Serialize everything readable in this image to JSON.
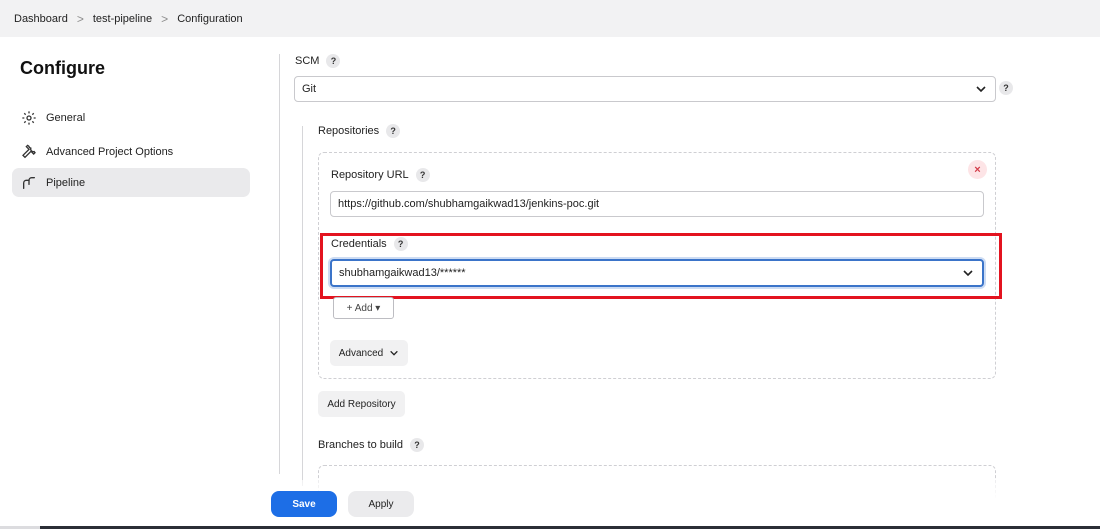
{
  "breadcrumb": {
    "items": [
      "Dashboard",
      "test-pipeline",
      "Configuration"
    ],
    "separator": ">"
  },
  "sidebar": {
    "title": "Configure",
    "items": [
      {
        "label": "General",
        "icon": "gear-icon"
      },
      {
        "label": "Advanced Project Options",
        "icon": "wrench-icon"
      },
      {
        "label": "Pipeline",
        "icon": "pipeline-icon",
        "active": true
      }
    ]
  },
  "scm": {
    "label": "SCM",
    "help": "?",
    "selected": "Git"
  },
  "repositories": {
    "label": "Repositories",
    "help": "?",
    "close_symbol": "×",
    "url_label": "Repository URL",
    "url_value": "https://github.com/shubhamgaikwad13/jenkins-poc.git",
    "credentials_label": "Credentials",
    "credentials_value": "shubhamgaikwad13/******",
    "add_label": "+ Add ▾",
    "advanced_label": "Advanced",
    "add_repository_label": "Add Repository"
  },
  "branches": {
    "label": "Branches to build",
    "help": "?"
  },
  "footer": {
    "save_label": "Save",
    "apply_label": "Apply"
  },
  "colors": {
    "primary": "#1d6ee6",
    "highlight": "#e3131f",
    "focus": "#3b74c9"
  }
}
